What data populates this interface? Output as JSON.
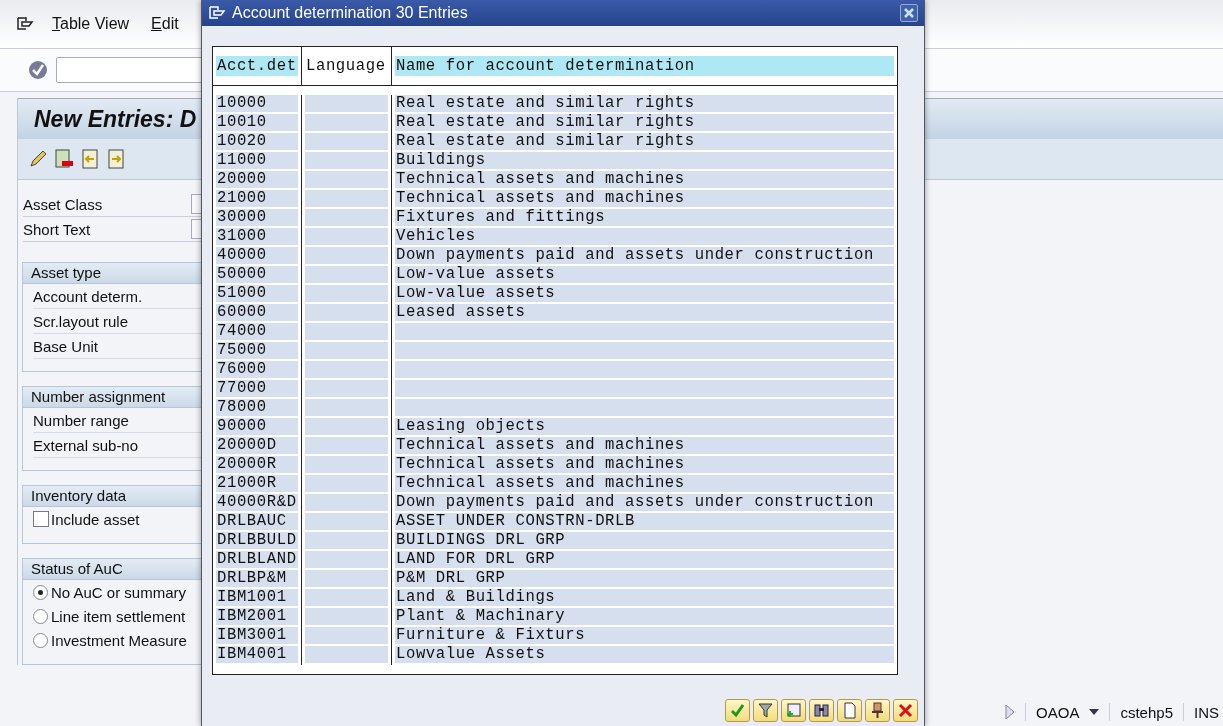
{
  "menu": [
    "Table View",
    "Edit"
  ],
  "screen_title": "New Entries: D",
  "top_fields": [
    "Asset Class",
    "Short Text"
  ],
  "groups": [
    {
      "title": "Asset type",
      "items": [
        {
          "kind": "label",
          "label": "Account determ."
        },
        {
          "kind": "label",
          "label": "Scr.layout rule"
        },
        {
          "kind": "label",
          "label": "Base Unit"
        }
      ]
    },
    {
      "title": "Number assignment",
      "items": [
        {
          "kind": "label",
          "label": "Number range"
        },
        {
          "kind": "label",
          "label": "External sub-no"
        }
      ]
    },
    {
      "title": "Inventory data",
      "items": [
        {
          "kind": "checkbox",
          "label": "Include asset",
          "checked": false
        }
      ]
    },
    {
      "title": "Status of AuC",
      "items": [
        {
          "kind": "radio",
          "label": "No AuC or summary",
          "selected": true
        },
        {
          "kind": "radio",
          "label": "Line item settlement",
          "selected": false
        },
        {
          "kind": "radio",
          "label": "Investment Measure",
          "selected": false
        }
      ]
    }
  ],
  "dialog": {
    "title": "Account determination 30 Entries",
    "columns": [
      {
        "label": "Acct.det",
        "highlighted": true
      },
      {
        "label": "Language",
        "highlighted": false
      },
      {
        "label": "Name for account determination",
        "highlighted": true
      }
    ],
    "rows": [
      [
        "10000",
        "",
        "Real estate and similar rights"
      ],
      [
        "10010",
        "",
        "Real estate and similar rights"
      ],
      [
        "10020",
        "",
        "Real estate and similar rights"
      ],
      [
        "11000",
        "",
        "Buildings"
      ],
      [
        "20000",
        "",
        "Technical assets and machines"
      ],
      [
        "21000",
        "",
        "Technical assets and machines"
      ],
      [
        "30000",
        "",
        "Fixtures and fittings"
      ],
      [
        "31000",
        "",
        "Vehicles"
      ],
      [
        "40000",
        "",
        "Down payments paid and assets under construction"
      ],
      [
        "50000",
        "",
        "Low-value assets"
      ],
      [
        "51000",
        "",
        "Low-value assets"
      ],
      [
        "60000",
        "",
        "Leased assets"
      ],
      [
        "74000",
        "",
        ""
      ],
      [
        "75000",
        "",
        ""
      ],
      [
        "76000",
        "",
        ""
      ],
      [
        "77000",
        "",
        ""
      ],
      [
        "78000",
        "",
        ""
      ],
      [
        "90000",
        "",
        "Leasing objects"
      ],
      [
        "20000D",
        "",
        "Technical assets and machines"
      ],
      [
        "20000R",
        "",
        "Technical assets and machines"
      ],
      [
        "21000R",
        "",
        "Technical assets and machines"
      ],
      [
        "40000R&D",
        "",
        "Down payments paid and assets under construction"
      ],
      [
        "DRLBAUC",
        "",
        "ASSET UNDER CONSTRN-DRLB"
      ],
      [
        "DRLBBULD",
        "",
        "BUILDINGS DRL GRP"
      ],
      [
        "DRLBLAND",
        "",
        "LAND FOR DRL GRP"
      ],
      [
        "DRLBP&M",
        "",
        "P&M DRL GRP"
      ],
      [
        "IBM1001",
        "",
        "Land & Buildings"
      ],
      [
        "IBM2001",
        "",
        "Plant & Machinary"
      ],
      [
        "IBM3001",
        "",
        "Furniture & Fixturs"
      ],
      [
        "IBM4001",
        "",
        "Lowvalue Assets"
      ]
    ]
  },
  "status_bar": {
    "transaction": "OAOA",
    "server": "cstehp5",
    "mode": "INS"
  }
}
